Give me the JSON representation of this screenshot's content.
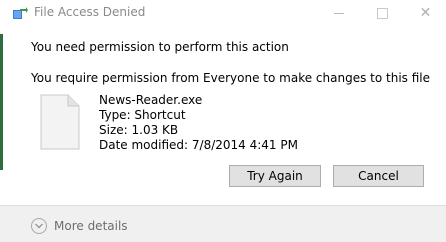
{
  "window": {
    "title": "File Access Denied"
  },
  "message": {
    "heading": "You need permission to perform this action",
    "subheading": "You require permission from Everyone to make changes to this file"
  },
  "file": {
    "name": "News-Reader.exe",
    "type": "Type: Shortcut",
    "size": "Size: 1.03 KB",
    "date_modified": "Date modified: 7/8/2014 4:41 PM",
    "icon": "blank-document-icon"
  },
  "buttons": {
    "try_again": "Try Again",
    "cancel": "Cancel"
  },
  "footer": {
    "more_details": "More details",
    "icon": "chevron-down-icon"
  },
  "icons": {
    "app": "permission-arrow-icon",
    "minimize": "minimize-icon",
    "maximize": "maximize-icon",
    "close": "close-icon"
  },
  "colors": {
    "accent_strip": "#2e6e3e",
    "button_face": "#e1e1e1",
    "footer_bg": "#f0f0f0"
  }
}
